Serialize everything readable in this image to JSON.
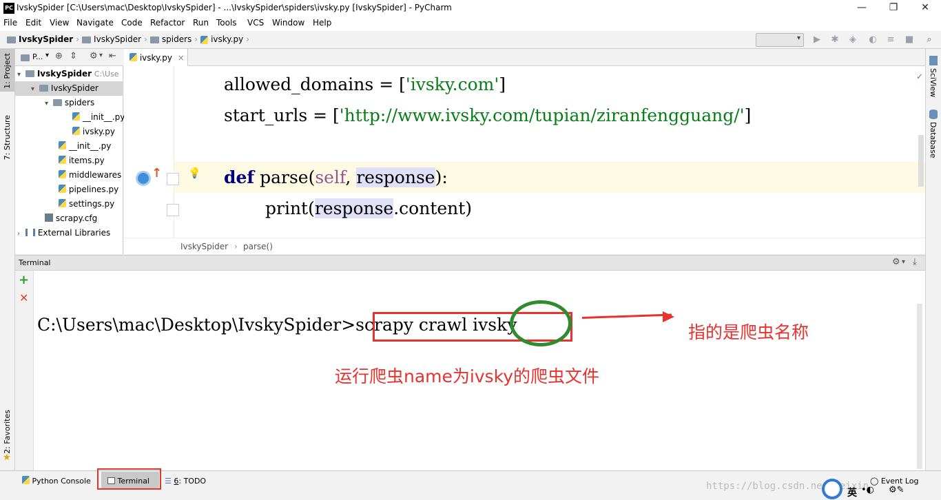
{
  "titlebar": {
    "app_icon": "PC",
    "title": "IvskySpider [C:\\Users\\mac\\Desktop\\IvskySpider] - ...\\IvskySpider\\spiders\\ivsky.py [IvskySpider] - PyCharm",
    "minimize": "—",
    "maximize": "❐",
    "close": "✕"
  },
  "menu": [
    "File",
    "Edit",
    "View",
    "Navigate",
    "Code",
    "Refactor",
    "Run",
    "Tools",
    "VCS",
    "Window",
    "Help"
  ],
  "breadcrumb": [
    "IvskySpider",
    "IvskySpider",
    "spiders",
    "ivsky.py"
  ],
  "left_stripe": {
    "project_tab": "1: Project",
    "structure_tab": "7: Structure",
    "favorites_tab": "2: Favorites"
  },
  "right_stripe": {
    "sciview_tab": "SciView",
    "database_tab": "Database"
  },
  "project": {
    "header_label": "P...",
    "tree": [
      {
        "label": "IvskySpider",
        "suffix": "C:\\Use",
        "level": 0,
        "type": "folder",
        "expanded": true,
        "bold": true
      },
      {
        "label": "IvskySpider",
        "level": 1,
        "type": "folder",
        "expanded": true,
        "selected": true
      },
      {
        "label": "spiders",
        "level": 2,
        "type": "folder",
        "expanded": true
      },
      {
        "label": "__init__.py",
        "level": 3,
        "type": "py"
      },
      {
        "label": "ivsky.py",
        "level": 3,
        "type": "py"
      },
      {
        "label": "__init__.py",
        "level": 2,
        "type": "py"
      },
      {
        "label": "items.py",
        "level": 2,
        "type": "py"
      },
      {
        "label": "middlewares",
        "level": 2,
        "type": "py"
      },
      {
        "label": "pipelines.py",
        "level": 2,
        "type": "py"
      },
      {
        "label": "settings.py",
        "level": 2,
        "type": "py"
      },
      {
        "label": "scrapy.cfg",
        "level": 1,
        "type": "cfg"
      },
      {
        "label": "External Libraries",
        "level": 0,
        "type": "lib",
        "collapsed": true
      }
    ]
  },
  "editor": {
    "tab_label": "ivsky.py",
    "tab_close": "×",
    "line1": {
      "name": "allowed_domains",
      "op": " = [",
      "str": "'ivsky.com'",
      "end": "]"
    },
    "line2": {
      "name": "start_urls",
      "op": " = [",
      "str": "'http://www.ivsky.com/tupian/ziranfengguang/'",
      "end": "]"
    },
    "line3": {
      "kw": "def",
      "fname": " parse(",
      "self": "self",
      ", ": ", ",
      "arg": "response",
      "end": "):"
    },
    "line4": {
      "fn": "print(",
      "arg": "response",
      ".content)": ".content)"
    },
    "breadcrumb": [
      "IvskySpider",
      "parse()"
    ]
  },
  "terminal": {
    "title": "Terminal",
    "prompt": "C:\\Users\\mac\\Desktop\\IvskySpider>",
    "command_pre": "scrapy crawl ",
    "command_name": "ivsky",
    "annotation_right": "指的是爬虫名称",
    "annotation_below": "运行爬虫name为ivsky的爬虫文件"
  },
  "bottom": {
    "python_console": "Python Console",
    "terminal": "Terminal",
    "todo_num": "6",
    "todo": ": TODO",
    "event_log": "Event Log",
    "watermark": "https://blog.csdn.net/weixin_"
  },
  "ime": {
    "lang": "英"
  },
  "colors": {
    "annotation_red": "#e8322e",
    "circle_green": "#2e8b2e",
    "string_green": "#067d17",
    "keyword_navy": "#000080"
  }
}
